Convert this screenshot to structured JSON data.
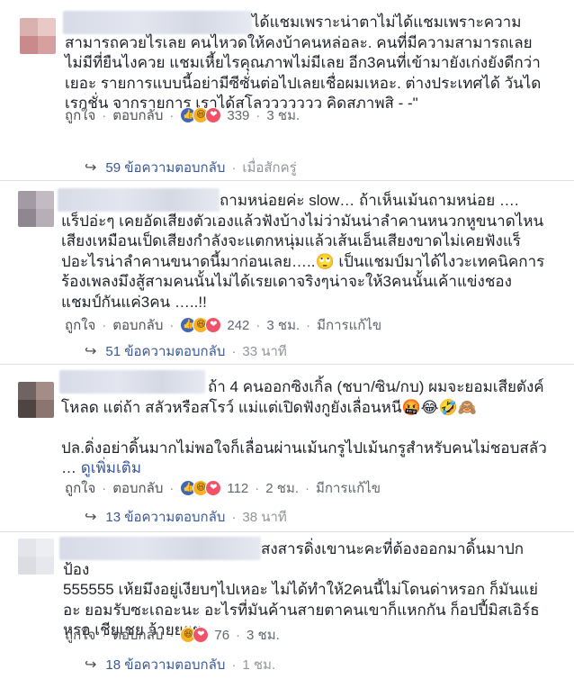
{
  "colors": {
    "link": "#385898",
    "text": "#1d2129",
    "meta": "#606770",
    "like": "#4267b2",
    "haha": "#f7b125",
    "love": "#f25268"
  },
  "comments": [
    {
      "text": "ได้แชมเพราะน่าตาไม่ได้แชมเพราะความ\nสามารถควยไรเลย คนไหวดให้คงบ้าคนหล่อละ. คนที่มีความสามารถเลย\nไม่มีที่ยืนไงควย แชมเหี้ยไรคุณภาพไม่มีเลย อีก3คนที่เข้ามายังเก่งยังดีกว่า\nเยอะ รายการแบบนี้อย่ามีซีซั่นต่อไปเลยเชื่อผมเหอะ. ต่างประเทศได้ วันได\nเรกชั่น จากรายการ เราได้สโลววววววว คิดสภาพสิ - -\"",
      "like_label": "ถูกใจ",
      "reply_label": "ตอบกลับ",
      "reaction_icons": [
        "like-icon",
        "haha-icon",
        "love-icon"
      ],
      "reaction_count": "339",
      "time": "3 ชม.",
      "replies": {
        "label": "59 ข้อความตอบกลับ",
        "time": "เมื่อสักครู่"
      }
    },
    {
      "text": "ถามหน่อยค่ะ slow… ถ้าเห็นเม้นถามหน่อย ….\nแร็ปอ่ะๆ เคยอัดเสียงตัวเองแล้วฟังบ้างไม่ว่ามันน่าลำคานหนวกหูขนาดไหน\nเสียงเหมือนเป็ดเสียงกำลังจะแตกหนุ่มแล้วเส้นเอ็นเสียงขาดไม่เคยฟังแร็\nปอะไรน่าลำคานขนาดนี้มาก่อนเลย…..🙄 เป็นแชมป์มาได้ไงวะเทคนิคการ\nร้องเพลงมึงสู้สามคนนั้นไม่ได้เรยเดาจริงๆน่าจะให้3คนนั้นเค้าแข่งชอง\nแชมป์กันแค่3คน …..!!",
      "like_label": "ถูกใจ",
      "reply_label": "ตอบกลับ",
      "reaction_icons": [
        "like-icon",
        "haha-icon",
        "love-icon"
      ],
      "reaction_count": "242",
      "time": "3 ชม.",
      "edited": "มีการแก้ไข",
      "replies": {
        "label": "51 ข้อความตอบกลับ",
        "time": "33 นาที"
      }
    },
    {
      "text": "ถ้า 4 คนออกซิงเกิ้ล (ชบา/ซิน/กบ) ผมจะยอมเสียตังค์\nโหลด แต่ถ้า สลัวหรือสโรว์ แม่แต่เปิดฟังกูยังเลื่อนหนี🤬😂🤣🙈\n\nปล.ดิ่งอย่าดิ้นมากไม่พอใจก็เลื่อนผ่านเม้นกรูไปเม้นกรูสำหรับคนไม่ชอบสลัว\n… ",
      "see_more": "ดูเพิ่มเติม",
      "like_label": "ถูกใจ",
      "reply_label": "ตอบกลับ",
      "reaction_icons": [
        "like-icon",
        "haha-icon",
        "love-icon"
      ],
      "reaction_count": "112",
      "time": "2 ชม.",
      "edited": "มีการแก้ไข",
      "replies": {
        "label": "13 ข้อความตอบกลับ",
        "time": "38 นาที"
      }
    },
    {
      "text": "สงสารดิ่งเขานะคะที่ต้องออกมาดิ้นมาปกป้อง\n555555 เห้ยมึงอยู่เงียบๆไปเหอะ ไม่ได้ทำให้2คนนี้ไม่โดนด่าหรอก ก็มันแย่\nอะ ยอมรับซะเถอะนะ อะไรที่มันค้านสายตาคนเขาก็แหกกัน ก็อปปี้มิสเอิร์ธ\nหรอ เชียเชย ว้ายยยย",
      "like_label": "ถูกใจ",
      "reply_label": "ตอบกลับ",
      "reaction_icons": [
        "haha-icon",
        "love-icon"
      ],
      "reaction_count": "76",
      "time": "3 ชม.",
      "replies": {
        "label": "18 ข้อความตอบกลับ",
        "time": "1 ชม."
      }
    }
  ]
}
